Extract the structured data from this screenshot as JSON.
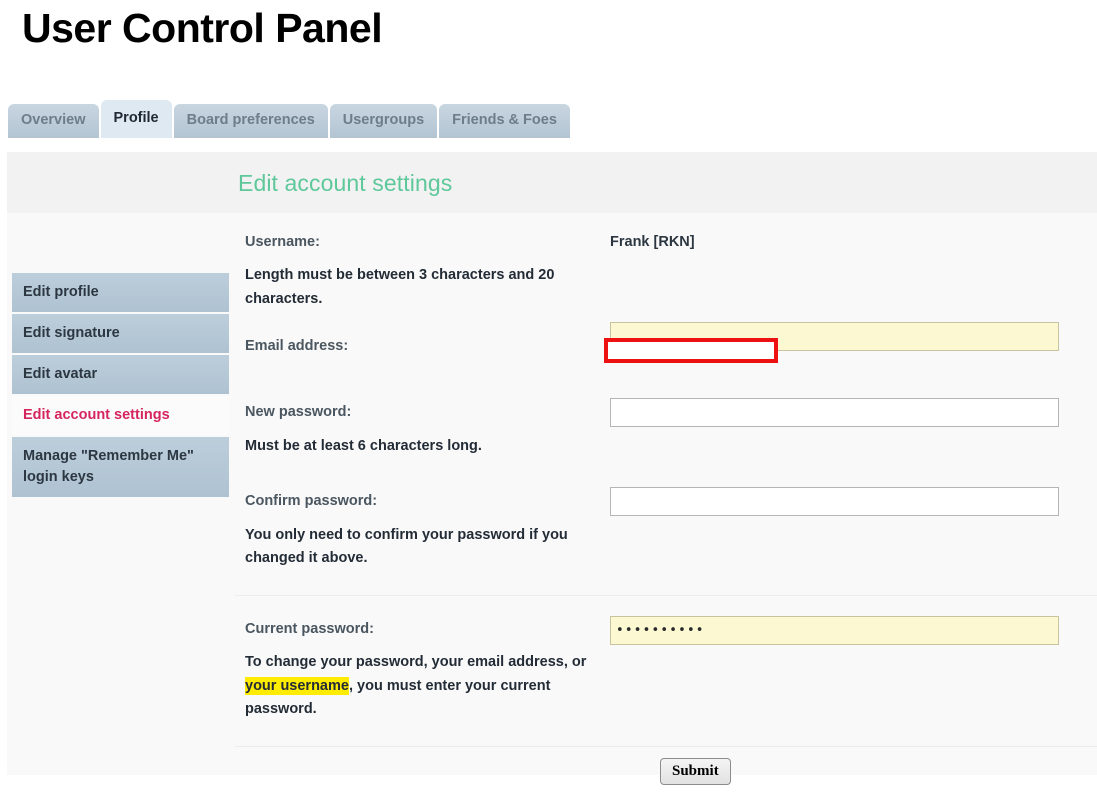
{
  "page": {
    "title": "User Control Panel"
  },
  "tabs": [
    {
      "label": "Overview",
      "active": false
    },
    {
      "label": "Profile",
      "active": true
    },
    {
      "label": "Board preferences",
      "active": false
    },
    {
      "label": "Usergroups",
      "active": false
    },
    {
      "label": "Friends & Foes",
      "active": false
    }
  ],
  "panel": {
    "heading": "Edit account settings"
  },
  "sidebar": {
    "items": [
      {
        "label": "Edit profile",
        "active": false
      },
      {
        "label": "Edit signature",
        "active": false
      },
      {
        "label": "Edit avatar",
        "active": false
      },
      {
        "label": "Edit account settings",
        "active": true
      },
      {
        "label": "Manage \"Remember Me\" login keys",
        "active": false
      }
    ]
  },
  "form": {
    "username": {
      "label": "Username:",
      "value": "Frank [RKN]",
      "description": "Length must be between 3 characters and 20 characters."
    },
    "email": {
      "label": "Email address:",
      "value": "",
      "placeholder": ""
    },
    "new_password": {
      "label": "New password:",
      "value": "",
      "description": "Must be at least 6 characters long."
    },
    "confirm_password": {
      "label": "Confirm password:",
      "value": "",
      "description": "You only need to confirm your password if you changed it above."
    },
    "current_password": {
      "label": "Current password:",
      "value": "••••••••••",
      "description_before": "To change your password, your email address, or ",
      "description_highlight": "your username",
      "description_after": ", you must enter your current password."
    },
    "submit_label": "Submit"
  },
  "annotations": {
    "email_highlight_color": "#ee1111",
    "username_marker_color": "#ffec00"
  },
  "colors": {
    "heading_green": "#5ec89b",
    "active_sidebar_text": "#d6245e",
    "tab_inactive_bg": "#b3c4d2",
    "tab_active_bg": "#dfe9f1",
    "autofill_yellow": "#fbf8d2"
  }
}
